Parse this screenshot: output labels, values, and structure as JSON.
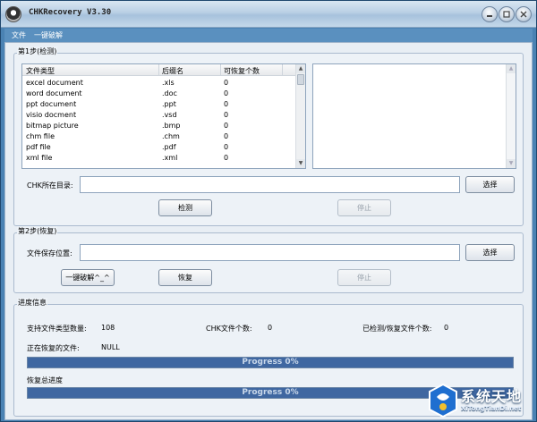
{
  "window": {
    "title": "CHKRecovery V3.30"
  },
  "menu": {
    "file": "文件",
    "one_click": "一键破解"
  },
  "step1": {
    "legend": "第1步(检测)",
    "columns": [
      "文件类型",
      "后缀名",
      "可恢复个数"
    ],
    "rows": [
      [
        "excel document",
        ".xls",
        "0"
      ],
      [
        "word document",
        ".doc",
        "0"
      ],
      [
        "ppt document",
        ".ppt",
        "0"
      ],
      [
        "visio docment",
        ".vsd",
        "0"
      ],
      [
        "bitmap picture",
        ".bmp",
        "0"
      ],
      [
        "chm file",
        ".chm",
        "0"
      ],
      [
        "pdf file",
        ".pdf",
        "0"
      ],
      [
        "xml file",
        ".xml",
        "0"
      ]
    ],
    "chk_dir_label": "CHK所在目录:",
    "chk_dir_value": "",
    "select_label": "选择",
    "detect_label": "检测",
    "stop_label": "停止"
  },
  "step2": {
    "legend": "第2步(恢复)",
    "save_label": "文件保存位置:",
    "save_value": "",
    "select_label": "选择",
    "one_click_label": "一键破解^_^",
    "recover_label": "恢复",
    "stop_label": "停止"
  },
  "progress": {
    "legend": "进度信息",
    "supported_label": "支持文件类型数量:",
    "supported_value": "108",
    "chk_count_label": "CHK文件个数:",
    "chk_count_value": "0",
    "detected_label": "已检测/恢复文件个数:",
    "detected_value": "0",
    "current_label": "正在恢复的文件:",
    "current_value": "NULL",
    "file_progress": {
      "text": "Progress 0%",
      "fraction": 0
    },
    "total_label": "恢复总进度",
    "total_progress": {
      "text": "Progress 0%",
      "fraction": 0
    }
  },
  "watermark": {
    "brand": "系统天地",
    "site": "XiTongTianDi.net"
  }
}
